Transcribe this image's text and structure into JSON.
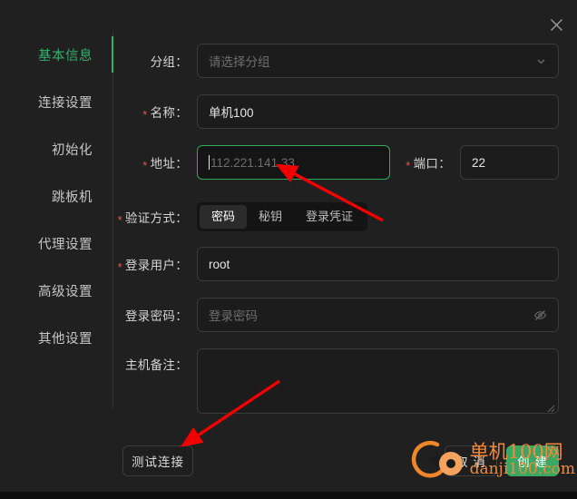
{
  "window": {
    "close_label": "×",
    "accent_color": "#35b06a",
    "required_color": "#e05a4f",
    "background": "#202020"
  },
  "sidebar": {
    "items": [
      {
        "label": "基本信息",
        "active": true
      },
      {
        "label": "连接设置",
        "active": false
      },
      {
        "label": "初始化",
        "active": false
      },
      {
        "label": "跳板机",
        "active": false
      },
      {
        "label": "代理设置",
        "active": false
      },
      {
        "label": "高级设置",
        "active": false
      },
      {
        "label": "其他设置",
        "active": false
      }
    ]
  },
  "form": {
    "group": {
      "label": "分组：",
      "required": false,
      "placeholder": "请选择分组",
      "value": "",
      "icon": "chevron-down-icon"
    },
    "name": {
      "label": "名称：",
      "required": true,
      "value": "单机100"
    },
    "address": {
      "label": "地址：",
      "required": true,
      "placeholder": "112.221.141.33",
      "value": "",
      "focused": true
    },
    "port": {
      "label": "端口：",
      "required": true,
      "value": "22"
    },
    "auth": {
      "label": "验证方式：",
      "required": true,
      "tabs": [
        {
          "label": "密码",
          "active": true
        },
        {
          "label": "秘钥",
          "active": false
        },
        {
          "label": "登录凭证",
          "active": false
        }
      ]
    },
    "user": {
      "label": "登录用户：",
      "required": true,
      "value": "root"
    },
    "password": {
      "label": "登录密码：",
      "required": false,
      "placeholder": "登录密码",
      "value": "",
      "icon": "eye-off-icon"
    },
    "remark": {
      "label": "主机备注：",
      "required": false,
      "value": ""
    }
  },
  "footer": {
    "test_connection": "测试连接",
    "cancel": "取 消",
    "create": "创 建"
  },
  "watermark": {
    "line1": "单机100网",
    "line2": "danji100.com",
    "color": "#f08a3c"
  }
}
